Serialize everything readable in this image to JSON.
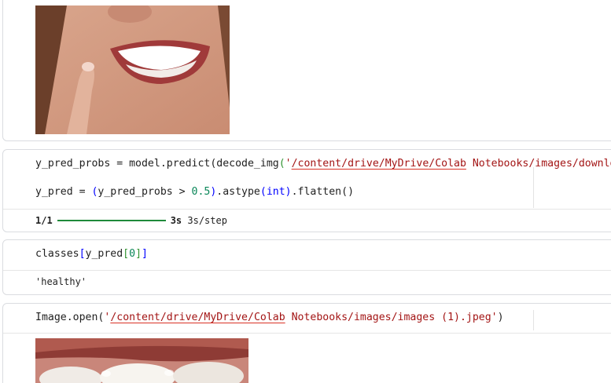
{
  "cell1": {
    "image_alt": "smiling mouth with finger on cheek"
  },
  "cell2": {
    "line1_var": "y_pred_probs",
    "line1_eq": " = ",
    "line1_obj": "model",
    "line1_dot": ".",
    "line1_fn": "predict",
    "line1_paren": "(",
    "line1_fn2": "decode_img",
    "line1_paren2": "(",
    "line1_str_a": "'",
    "line1_str_b": "/content/drive/MyDrive/Colab",
    "line1_str_c": " Notebooks",
    "line1_str_d": "/images/downlo",
    "line2_var": "y_pred",
    "line2_eq": " = ",
    "line2_open": "(",
    "line2_inner": "y_pred_probs > ",
    "line2_num": "0.5",
    "line2_close": ")",
    "line2_method1": ".astype",
    "line2_open2": "(",
    "line2_type": "int",
    "line2_close2": ")",
    "line2_method2": ".flatten",
    "line2_tail": "()",
    "output_steps": "1/1",
    "output_time": "3s",
    "output_rate": "3s/step"
  },
  "cell3": {
    "code_obj": "classes",
    "code_open": "[",
    "code_inner": "y_pred",
    "code_open2": "[",
    "code_num": "0",
    "code_close2": "]",
    "code_close": "]",
    "output": "'healthy'"
  },
  "cell4": {
    "code_obj": "Image",
    "code_dot": ".",
    "code_fn": "open",
    "code_open": "(",
    "code_str_a": "'",
    "code_str_b": "/content/drive/MyDrive/Colab",
    "code_str_c": " Notebooks/images/images (1).jpeg'",
    "code_close": ")",
    "image_alt": "close-up of teeth"
  },
  "colors": {
    "progress": "#1f8a3a",
    "string": "#a31515",
    "number": "#098658",
    "keyword": "#0000ff",
    "border": "#dadce0"
  }
}
